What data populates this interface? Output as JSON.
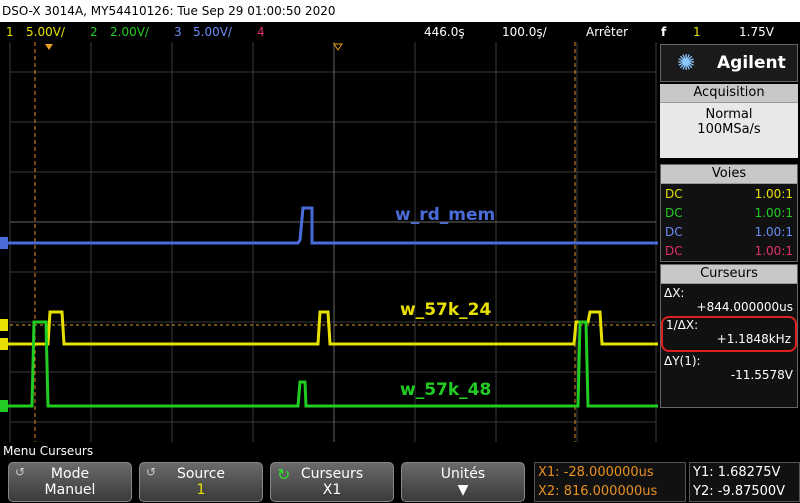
{
  "window": {
    "title": "DSO-X 3014A, MY54410126: Tue Sep 29 01:00:50 2020"
  },
  "status": {
    "ch1_num": "1",
    "ch1_scale": "5.00V/",
    "ch2_num": "2",
    "ch2_scale": "2.00V/",
    "ch3_num": "3",
    "ch3_scale": "5.00V/",
    "ch4_num": "4",
    "timebase": "446.0ş",
    "time_scale": "100.0ş/",
    "run_state": "Arrêter",
    "trigger_source": "1",
    "trigger_level": "1.75V"
  },
  "plot": {
    "traces": [
      {
        "name": "w_rd_mem",
        "color": "#4a6cd8"
      },
      {
        "name": "w_57k_24",
        "color": "#e8e000"
      },
      {
        "name": "w_57k_48",
        "color": "#22cc22"
      }
    ],
    "markers": {
      "ch3": "3",
      "ch1": "1",
      "ch2": "2",
      "trig": "T"
    }
  },
  "side": {
    "brand": "Agilent",
    "acquisition": {
      "header": "Acquisition",
      "mode": "Normal",
      "rate": "100MSa/s"
    },
    "voies": {
      "header": "Voies",
      "rows": [
        {
          "coupling": "DC",
          "ratio": "1.00:1",
          "color": "#e8e000"
        },
        {
          "coupling": "DC",
          "ratio": "1.00:1",
          "color": "#22cc22"
        },
        {
          "coupling": "DC",
          "ratio": "1.00:1",
          "color": "#4a6cd8"
        },
        {
          "coupling": "DC",
          "ratio": "1.00:1",
          "color": "#e0306a"
        }
      ]
    },
    "curseurs": {
      "header": "Curseurs",
      "dx_label": "ΔX:",
      "dx_value": "+844.000000us",
      "inv_dx_label": "1/ΔX:",
      "inv_dx_value": "+1.1848kHz",
      "dy_label": "ΔY(1):",
      "dy_value": "-11.5578V"
    }
  },
  "menu": {
    "title": "Menu Curseurs",
    "softkeys": [
      {
        "label": "Mode",
        "value": "Manuel"
      },
      {
        "label": "Source",
        "value": "1"
      },
      {
        "label": "Curseurs",
        "value": "X1"
      },
      {
        "label": "Unités",
        "value": ""
      }
    ],
    "readout": {
      "x1": "X1: -28.000000us",
      "x2": "X2: 816.000000us",
      "y1": "Y1: 1.68275V",
      "y2": "Y2: -9.87500V"
    }
  }
}
